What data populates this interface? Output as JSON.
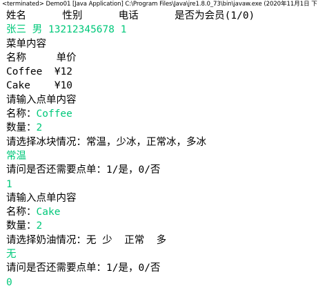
{
  "console": {
    "title": "<terminated> Demo01 [Java Application] C:\\Program Files\\Java\\jre1.8.0_73\\bin\\javaw.exe (2020年11月1日 下"
  },
  "colors": {
    "output": "#000000",
    "user_input": "#00c87a"
  },
  "lines": [
    {
      "text": "姓名      性别      电话      是否为会员(1/0)",
      "kind": "output"
    },
    {
      "text": "张三 男 13212345678 1",
      "kind": "input"
    },
    {
      "text": "菜单内容",
      "kind": "output"
    },
    {
      "text": "名称     单价",
      "kind": "output"
    },
    {
      "text": "Coffee  ¥12",
      "kind": "output"
    },
    {
      "text": "Cake    ¥10",
      "kind": "output"
    },
    {
      "text": "请输入点单内容",
      "kind": "output"
    },
    {
      "prompt": "名称：",
      "value": "Coffee",
      "kind": "mixed"
    },
    {
      "prompt": "数量：",
      "value": "2",
      "kind": "mixed"
    },
    {
      "text": "请选择冰块情况：常温，少冰，正常冰，多冰",
      "kind": "output"
    },
    {
      "text": "常温",
      "kind": "input"
    },
    {
      "text": "请问是否还需要点单：1/是，0/否",
      "kind": "output"
    },
    {
      "text": "1",
      "kind": "input"
    },
    {
      "text": "请输入点单内容",
      "kind": "output"
    },
    {
      "prompt": "名称：",
      "value": "Cake",
      "kind": "mixed"
    },
    {
      "prompt": "数量：",
      "value": "2",
      "kind": "mixed"
    },
    {
      "text": "请选择奶油情况：无 少  正常  多",
      "kind": "output"
    },
    {
      "text": "无",
      "kind": "input"
    },
    {
      "text": "请问是否还需要点单：1/是，0/否",
      "kind": "output"
    },
    {
      "text": "0",
      "kind": "input"
    }
  ]
}
